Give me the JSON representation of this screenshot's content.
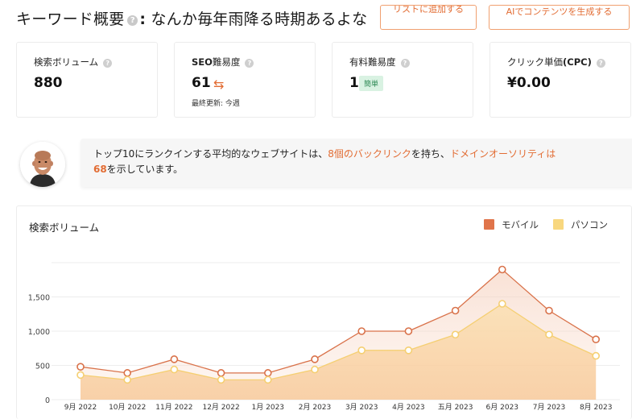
{
  "header": {
    "title_prefix": "キーワード概要",
    "title_colon": ":",
    "keyword": "なんか毎年雨降る時期あるよな",
    "help_glyph": "?",
    "add_to_list_label": "リストに追加する",
    "ai_content_label": "AIでコンテンツを生成する"
  },
  "metrics": [
    {
      "label": "検索ボリューム",
      "value": "880"
    },
    {
      "label_bold": "SEO",
      "label": "難易度",
      "value": "61",
      "sub": "最終更新: 今週"
    },
    {
      "label": "有料難易度",
      "value": "1",
      "badge": "簡単"
    },
    {
      "label": "クリック単価",
      "label_bold": "(CPC)",
      "value": "¥0.00"
    }
  ],
  "info": {
    "part1": "トップ10にランクインする平均的なウェブサイトは、",
    "backlinks": "8個のバックリンク",
    "part2": "を持ち、",
    "authority": "ドメインオーソリティは",
    "authority_value": "68",
    "part3": "を示しています。"
  },
  "colors": {
    "accent": "#e26c33",
    "mobile": "#d9724a",
    "desktop": "#f8d27a",
    "badge_bg": "#d9f2e2",
    "badge_text": "#2f8a56"
  },
  "chart_data": {
    "type": "line",
    "title": "検索ボリューム",
    "categories": [
      "9月 2022",
      "10月 2022",
      "11月 2022",
      "12月 2022",
      "1月 2023",
      "2月 2023",
      "3月 2023",
      "4月 2023",
      "五月 2023",
      "6月 2023",
      "7月 2023",
      "8月 2023"
    ],
    "series": [
      {
        "name": "モバイル",
        "values": [
          480,
          390,
          590,
          390,
          390,
          590,
          1000,
          1000,
          1300,
          1900,
          1300,
          880
        ]
      },
      {
        "name": "パソコン",
        "values": [
          360,
          290,
          440,
          290,
          290,
          440,
          720,
          720,
          950,
          1400,
          950,
          640
        ]
      }
    ],
    "yticks": [
      "0",
      "500",
      "1,000",
      "1,500"
    ],
    "ytick_values": [
      0,
      500,
      1000,
      1500
    ],
    "ylim": [
      0,
      2000
    ],
    "grid": true,
    "legend": "top-right"
  }
}
